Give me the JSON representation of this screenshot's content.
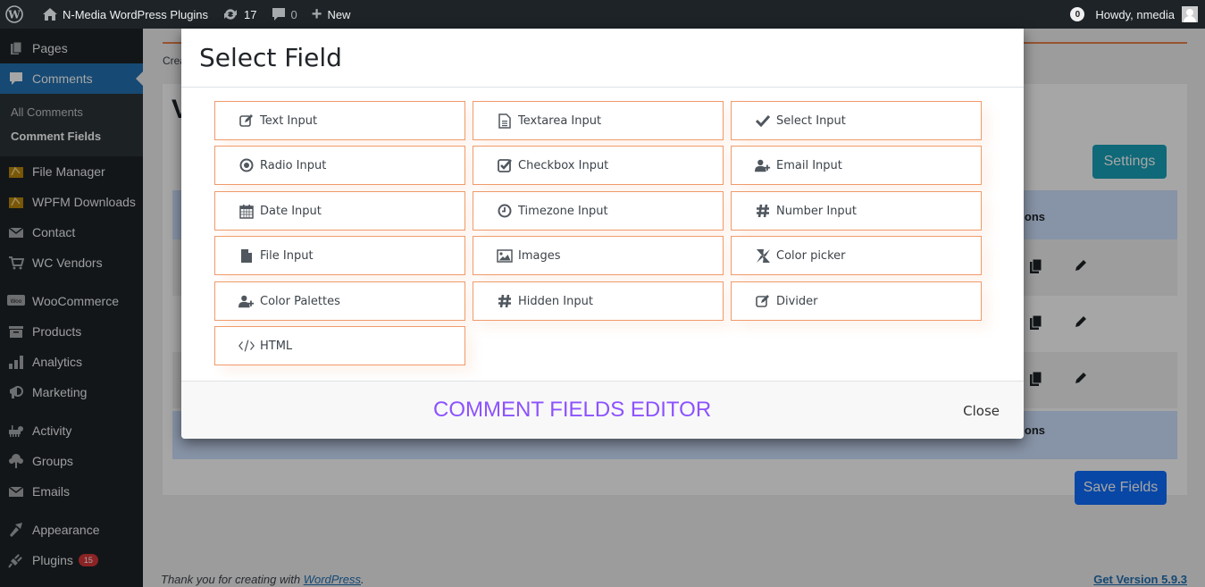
{
  "adminbar": {
    "site_name": "N-Media WordPress Plugins",
    "updates_count": "17",
    "comments_count": "0",
    "new_label": "New",
    "notifications_count": "0",
    "greeting": "Howdy, nmedia"
  },
  "sidebar": {
    "items": [
      {
        "label": "Pages",
        "icon": "pages-icon"
      },
      {
        "label": "Comments",
        "icon": "comments-icon"
      },
      {
        "label": "File Manager",
        "icon": "file-manager-icon"
      },
      {
        "label": "WPFM Downloads",
        "icon": "wpfm-downloads-icon"
      },
      {
        "label": "Contact",
        "icon": "envelope-icon"
      },
      {
        "label": "WC Vendors",
        "icon": "cart-icon"
      },
      {
        "label": "WooCommerce",
        "icon": "woo-icon"
      },
      {
        "label": "Products",
        "icon": "archive-icon"
      },
      {
        "label": "Analytics",
        "icon": "chart-bar-icon"
      },
      {
        "label": "Marketing",
        "icon": "megaphone-icon"
      },
      {
        "label": "Activity",
        "icon": "activity-icon"
      },
      {
        "label": "Groups",
        "icon": "groups-icon"
      },
      {
        "label": "Emails",
        "icon": "envelope-icon"
      },
      {
        "label": "Appearance",
        "icon": "paintbrush-icon"
      },
      {
        "label": "Plugins",
        "icon": "plugin-icon",
        "badge": "15"
      }
    ],
    "submenu": [
      {
        "label": "All Comments"
      },
      {
        "label": "Comment Fields"
      }
    ]
  },
  "main": {
    "breadcrumb_fragment": "Crea",
    "heading_fragment": "V",
    "settings_label": "Settings",
    "table_header_actions": "ctions",
    "table_footer_actions": "ctions",
    "save_label": "Save Fields",
    "footer_text": "Thank you for creating with ",
    "footer_link": "WordPress",
    "footer_period": ".",
    "version_link": "Get Version 5.9.3"
  },
  "modal": {
    "title": "Select Field",
    "fields": [
      {
        "label": "Text Input",
        "icon": "edit-icon"
      },
      {
        "label": "Textarea Input",
        "icon": "file-text-icon"
      },
      {
        "label": "Select Input",
        "icon": "check-icon"
      },
      {
        "label": "Radio Input",
        "icon": "radio-icon"
      },
      {
        "label": "Checkbox Input",
        "icon": "checkbox-icon"
      },
      {
        "label": "Email Input",
        "icon": "user-plus-icon"
      },
      {
        "label": "Date Input",
        "icon": "calendar-icon"
      },
      {
        "label": "Timezone Input",
        "icon": "clock-icon"
      },
      {
        "label": "Number Input",
        "icon": "hashtag-icon"
      },
      {
        "label": "File Input",
        "icon": "file-icon"
      },
      {
        "label": "Images",
        "icon": "image-icon"
      },
      {
        "label": "Color picker",
        "icon": "pinwheel-icon"
      },
      {
        "label": "Color Palettes",
        "icon": "user-plus-icon"
      },
      {
        "label": "Hidden Input",
        "icon": "hashtag-icon"
      },
      {
        "label": "Divider",
        "icon": "edit-icon"
      },
      {
        "label": "HTML",
        "icon": "code-icon"
      }
    ],
    "footer_title": "COMMENT FIELDS EDITOR",
    "close_label": "Close"
  },
  "colors": {
    "accent_orange": "#f09a6a",
    "wp_blue": "#2271b1",
    "footer_title": "#8c52ff",
    "settings_teal": "#17a2b8",
    "save_blue": "#0d6efd"
  }
}
